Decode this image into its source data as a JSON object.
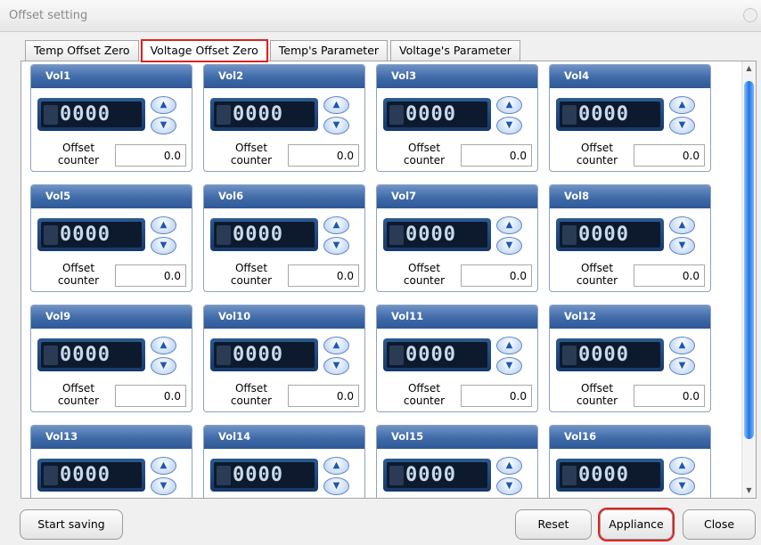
{
  "window": {
    "title": "Offset setting"
  },
  "tabs": [
    {
      "label": "Temp Offset Zero"
    },
    {
      "label": "Voltage Offset Zero"
    },
    {
      "label": "Temp's Parameter"
    },
    {
      "label": "Voltage's Parameter"
    }
  ],
  "active_tab": "Voltage Offset Zero",
  "channels": [
    {
      "name": "Vol1",
      "display": "0000",
      "offset_label": "Offset counter",
      "offset_value": "0.0"
    },
    {
      "name": "Vol2",
      "display": "0000",
      "offset_label": "Offset counter",
      "offset_value": "0.0"
    },
    {
      "name": "Vol3",
      "display": "0000",
      "offset_label": "Offset counter",
      "offset_value": "0.0"
    },
    {
      "name": "Vol4",
      "display": "0000",
      "offset_label": "Offset counter",
      "offset_value": "0.0"
    },
    {
      "name": "Vol5",
      "display": "0000",
      "offset_label": "Offset counter",
      "offset_value": "0.0"
    },
    {
      "name": "Vol6",
      "display": "0000",
      "offset_label": "Offset counter",
      "offset_value": "0.0"
    },
    {
      "name": "Vol7",
      "display": "0000",
      "offset_label": "Offset counter",
      "offset_value": "0.0"
    },
    {
      "name": "Vol8",
      "display": "0000",
      "offset_label": "Offset counter",
      "offset_value": "0.0"
    },
    {
      "name": "Vol9",
      "display": "0000",
      "offset_label": "Offset counter",
      "offset_value": "0.0"
    },
    {
      "name": "Vol10",
      "display": "0000",
      "offset_label": "Offset counter",
      "offset_value": "0.0"
    },
    {
      "name": "Vol11",
      "display": "0000",
      "offset_label": "Offset counter",
      "offset_value": "0.0"
    },
    {
      "name": "Vol12",
      "display": "0000",
      "offset_label": "Offset counter",
      "offset_value": "0.0"
    },
    {
      "name": "Vol13",
      "display": "0000"
    },
    {
      "name": "Vol14",
      "display": "0000"
    },
    {
      "name": "Vol15",
      "display": "0000"
    },
    {
      "name": "Vol16",
      "display": "0000"
    }
  ],
  "buttons": {
    "start_saving": "Start saving",
    "reset": "Reset",
    "appliance": "Appliance",
    "close": "Close"
  },
  "colors": {
    "highlight": "#e02020",
    "card_header": "#3f6aa8",
    "scroll_thumb": "#1f73e0"
  }
}
